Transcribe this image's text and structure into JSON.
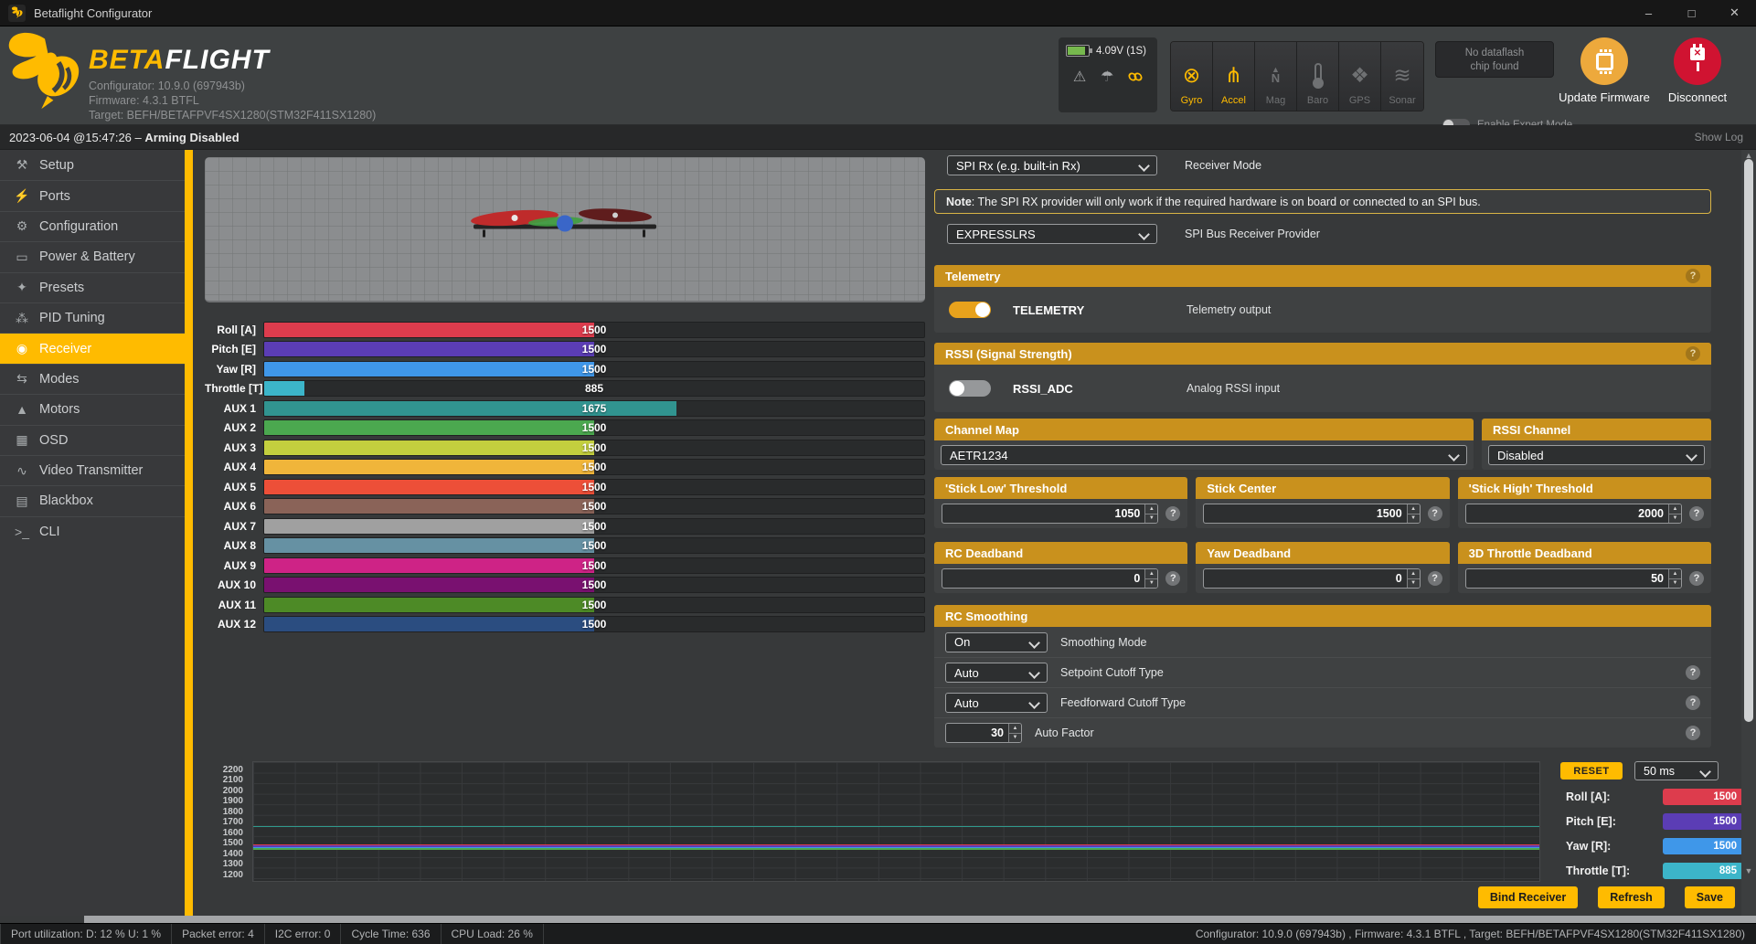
{
  "window": {
    "title": "Betaflight Configurator",
    "controls": {
      "minimize": "–",
      "maximize": "□",
      "close": "✕"
    }
  },
  "header": {
    "brand": {
      "name_left": "BETA",
      "name_right": "FLIGHT",
      "configurator": "Configurator: 10.9.0 (697943b)",
      "firmware": "Firmware: 4.3.1 BTFL",
      "target": "Target: BEFH/BETAFPVF4SX1280(STM32F411SX1280)"
    },
    "battery": {
      "voltage": "4.09V (1S)",
      "fill_color": "#77b94e"
    },
    "warning_icon": "⚠",
    "parachute_icon": "☂",
    "sensors": [
      {
        "label": "Gyro",
        "active": true,
        "glyph": "⊗",
        "icon": "gyro-icon"
      },
      {
        "label": "Accel",
        "active": true,
        "glyph": "⋔",
        "icon": "accelerometer-icon"
      },
      {
        "label": "Mag",
        "active": false,
        "glyph": "N",
        "icon": "magnetometer-icon",
        "special": "mag"
      },
      {
        "label": "Baro",
        "active": false,
        "glyph": "",
        "icon": "barometer-icon",
        "special": "baro"
      },
      {
        "label": "GPS",
        "active": false,
        "glyph": "❖",
        "icon": "gps-icon"
      },
      {
        "label": "Sonar",
        "active": false,
        "glyph": "≋",
        "icon": "sonar-icon"
      }
    ],
    "dataflash": {
      "line1": "No dataflash",
      "line2": "chip found"
    },
    "expert_mode_label": "Enable Expert Mode",
    "update_firmware_label": "Update Firmware",
    "disconnect_label": "Disconnect"
  },
  "log_bar": {
    "prefix": "2023-06-04 @15:47:26 – ",
    "status": "Arming Disabled",
    "show_log": "Show Log"
  },
  "sidebar": {
    "accent_color": "#ffbb00",
    "items": [
      {
        "label": "Setup",
        "glyph": "⚒",
        "icon": "wrench-icon"
      },
      {
        "label": "Ports",
        "glyph": "⚡",
        "icon": "plug-icon"
      },
      {
        "label": "Configuration",
        "glyph": "⚙",
        "icon": "gear-icon"
      },
      {
        "label": "Power & Battery",
        "glyph": "▭",
        "icon": "battery-icon"
      },
      {
        "label": "Presets",
        "glyph": "✦",
        "icon": "magic-wand-icon"
      },
      {
        "label": "PID Tuning",
        "glyph": "⁂",
        "icon": "sitemap-icon"
      },
      {
        "label": "Receiver",
        "glyph": "◉",
        "icon": "transmitter-icon",
        "active": true
      },
      {
        "label": "Modes",
        "glyph": "⇆",
        "icon": "toggles-icon"
      },
      {
        "label": "Motors",
        "glyph": "▲",
        "icon": "motor-icon"
      },
      {
        "label": "OSD",
        "glyph": "▦",
        "icon": "osd-icon"
      },
      {
        "label": "Video Transmitter",
        "glyph": "∿",
        "icon": "antenna-icon"
      },
      {
        "label": "Blackbox",
        "glyph": "▤",
        "icon": "blackbox-icon"
      },
      {
        "label": "CLI",
        "glyph": ">_",
        "icon": "terminal-icon"
      }
    ]
  },
  "receiver": {
    "channels": [
      {
        "label": "Roll [A]",
        "value": 1500,
        "color": "#dd3c4d"
      },
      {
        "label": "Pitch [E]",
        "value": 1500,
        "color": "#5b3db5"
      },
      {
        "label": "Yaw [R]",
        "value": 1500,
        "color": "#3f97e9"
      },
      {
        "label": "Throttle [T]",
        "value": 885,
        "color": "#3cb5c9"
      },
      {
        "label": "AUX 1",
        "value": 1675,
        "color": "#319490"
      },
      {
        "label": "AUX 2",
        "value": 1500,
        "color": "#4ba84f"
      },
      {
        "label": "AUX 3",
        "value": 1500,
        "color": "#c3cf3e"
      },
      {
        "label": "AUX 4",
        "value": 1500,
        "color": "#f0b53a"
      },
      {
        "label": "AUX 5",
        "value": 1500,
        "color": "#ed4f38"
      },
      {
        "label": "AUX 6",
        "value": 1500,
        "color": "#8a6358"
      },
      {
        "label": "AUX 7",
        "value": 1500,
        "color": "#a0a0a0"
      },
      {
        "label": "AUX 8",
        "value": 1500,
        "color": "#6691a3"
      },
      {
        "label": "AUX 9",
        "value": 1500,
        "color": "#ce2386"
      },
      {
        "label": "AUX 10",
        "value": 1500,
        "color": "#791170"
      },
      {
        "label": "AUX 11",
        "value": 1500,
        "color": "#4d8a26"
      },
      {
        "label": "AUX 12",
        "value": 1500,
        "color": "#2b4d80"
      }
    ],
    "meter_range": {
      "min": 800,
      "max": 2200
    },
    "receiver_mode": {
      "value": "SPI Rx (e.g. built-in Rx)",
      "label": "Receiver Mode"
    },
    "note": {
      "bold": "Note",
      "text": ": The SPI RX provider will only work if the required hardware is on board or connected to an SPI bus."
    },
    "spi_provider": {
      "value": "EXPRESSLRS",
      "label": "SPI Bus Receiver Provider"
    },
    "telemetry": {
      "section": "Telemetry",
      "switch_name": "TELEMETRY",
      "switch_on": true,
      "desc": "Telemetry output"
    },
    "rssi": {
      "section": "RSSI (Signal Strength)",
      "switch_name": "RSSI_ADC",
      "switch_on": false,
      "desc": "Analog RSSI input"
    },
    "channel_map": {
      "section": "Channel Map",
      "value": "AETR1234"
    },
    "rssi_channel": {
      "section": "RSSI Channel",
      "value": "Disabled"
    },
    "thresholds": [
      {
        "label": "'Stick Low' Threshold",
        "value": "1050"
      },
      {
        "label": "Stick Center",
        "value": "1500"
      },
      {
        "label": "'Stick High' Threshold",
        "value": "2000"
      }
    ],
    "deadbands": [
      {
        "label": "RC Deadband",
        "value": "0"
      },
      {
        "label": "Yaw Deadband",
        "value": "0"
      },
      {
        "label": "3D Throttle Deadband",
        "value": "50"
      }
    ],
    "rc_smoothing": {
      "section": "RC Smoothing",
      "rows": [
        {
          "value": "On",
          "label": "Smoothing Mode",
          "type": "select",
          "help": false
        },
        {
          "value": "Auto",
          "label": "Setpoint Cutoff Type",
          "type": "select",
          "help": true
        },
        {
          "value": "Auto",
          "label": "Feedforward Cutoff Type",
          "type": "select",
          "help": true
        },
        {
          "value": "30",
          "label": "Auto Factor",
          "type": "number",
          "help": true
        }
      ]
    }
  },
  "graph": {
    "ticks": [
      2200,
      2100,
      2000,
      1900,
      1800,
      1700,
      1600,
      1500,
      1400,
      1300,
      1200
    ],
    "levels": [
      {
        "value": 1675,
        "color": "#2f9a8d"
      },
      {
        "value": 1500,
        "color": "#dd3c4d"
      },
      {
        "value": 1500,
        "color": "#5b3db5"
      },
      {
        "value": 1500,
        "color": "#3f97e9"
      },
      {
        "value": 1500,
        "color": "#4ba84f"
      }
    ],
    "reset_label": "RESET",
    "interval": "50 ms",
    "legend": [
      {
        "label": "Roll [A]:",
        "value": "1500",
        "color": "#dd3c4d"
      },
      {
        "label": "Pitch [E]:",
        "value": "1500",
        "color": "#5b3db5"
      },
      {
        "label": "Yaw [R]:",
        "value": "1500",
        "color": "#3f97e9"
      },
      {
        "label": "Throttle [T]:",
        "value": "885",
        "color": "#3cb5c9"
      }
    ]
  },
  "actions": {
    "bind": "Bind Receiver",
    "refresh": "Refresh",
    "save": "Save"
  },
  "status_bar": {
    "cells": [
      "Port utilization: D: 12 % U: 1 %",
      "Packet error: 4",
      "I2C error: 0",
      "Cycle Time: 636",
      "CPU Load: 26 %"
    ],
    "right": "Configurator: 10.9.0 (697943b) , Firmware: 4.3.1 BTFL , Target: BEFH/BETAFPVF4SX1280(STM32F411SX1280)"
  }
}
